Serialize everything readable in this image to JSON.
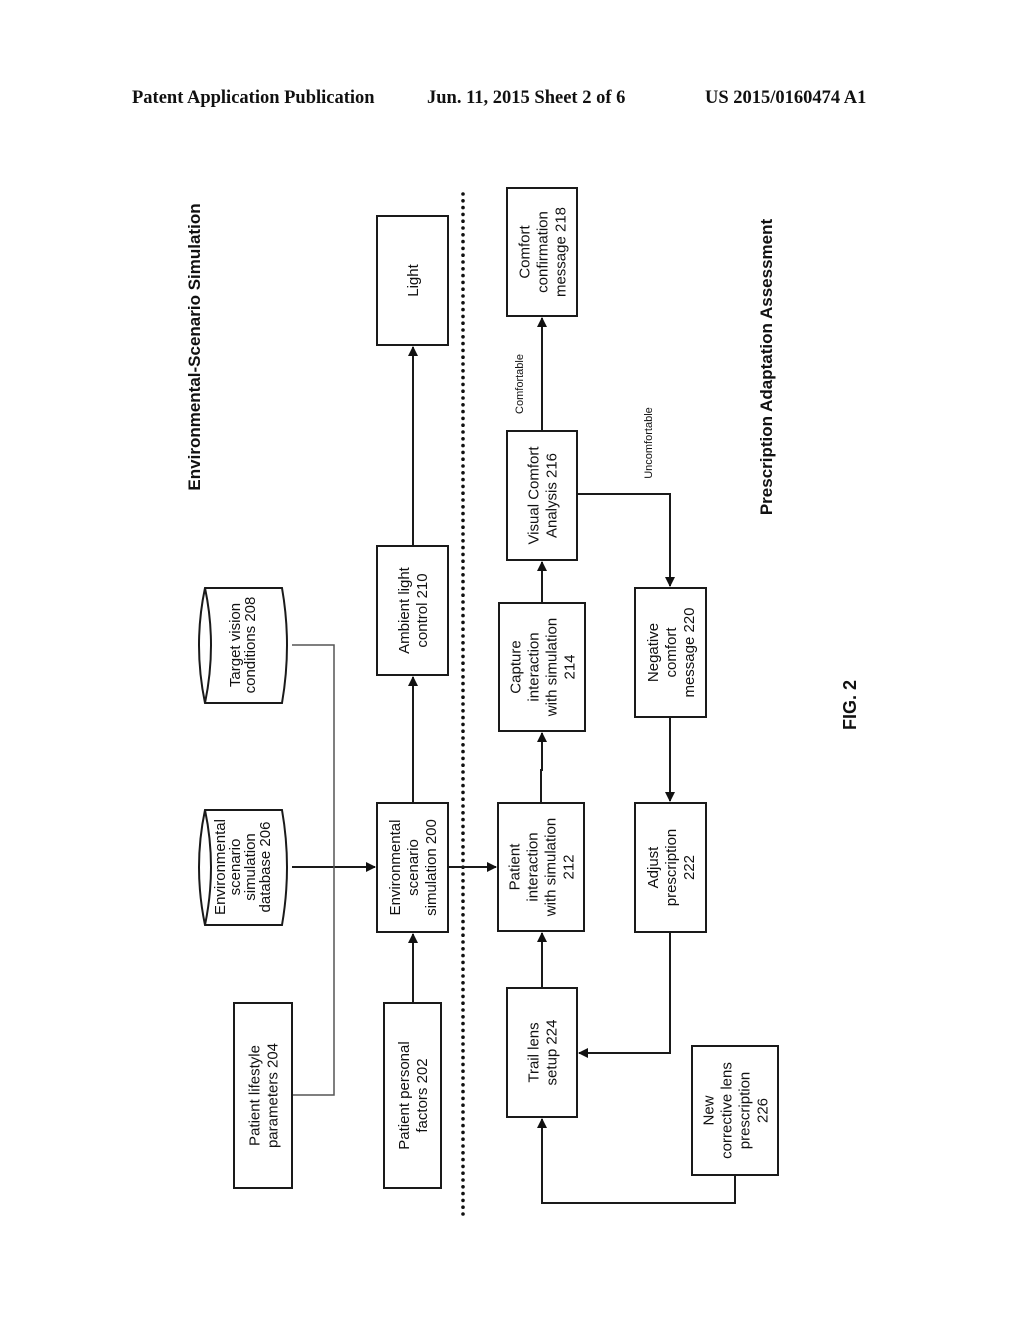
{
  "header": {
    "publication": "Patent Application Publication",
    "date_sheet": "Jun. 11, 2015  Sheet 2 of 6",
    "number": "US 2015/0160474 A1"
  },
  "sections": {
    "top": "Environmental-Scenario Simulation",
    "bottom": "Prescription Adaptation Assessment"
  },
  "figure_label": "FIG. 2",
  "nodes": {
    "light": [
      "Light"
    ],
    "ambient_210": [
      "Ambient light",
      "control 210"
    ],
    "env_sim_200": [
      "Environmental",
      "scenario",
      "simulation 200"
    ],
    "personal_202": [
      "Patient personal",
      "factors 202"
    ],
    "lifestyle_204": [
      "Patient lifestyle",
      "parameters 204"
    ],
    "db_206": [
      "Environmental",
      "scenario",
      "simulation",
      "database 206"
    ],
    "target_208": [
      "Target vision",
      "conditions 208"
    ],
    "comfort_218": [
      "Comfort",
      "confirmation",
      "message 218"
    ],
    "visual_216": [
      "Visual Comfort",
      "Analysis 216"
    ],
    "capture_214": [
      "Capture",
      "interaction",
      "with simulation",
      "214"
    ],
    "patient_212": [
      "Patient",
      "interaction",
      "with simulation",
      "212"
    ],
    "trail_224": [
      "Trail lens",
      "setup 224"
    ],
    "negative_220": [
      "Negative",
      "comfort",
      "message 220"
    ],
    "adjust_222": [
      "Adjust",
      "prescription",
      "222"
    ],
    "new_226": [
      "New",
      "corrective lens",
      "prescription",
      "226"
    ]
  },
  "edge_labels": {
    "comfortable": "Comfortable",
    "uncomfortable": "Uncomfortable"
  }
}
